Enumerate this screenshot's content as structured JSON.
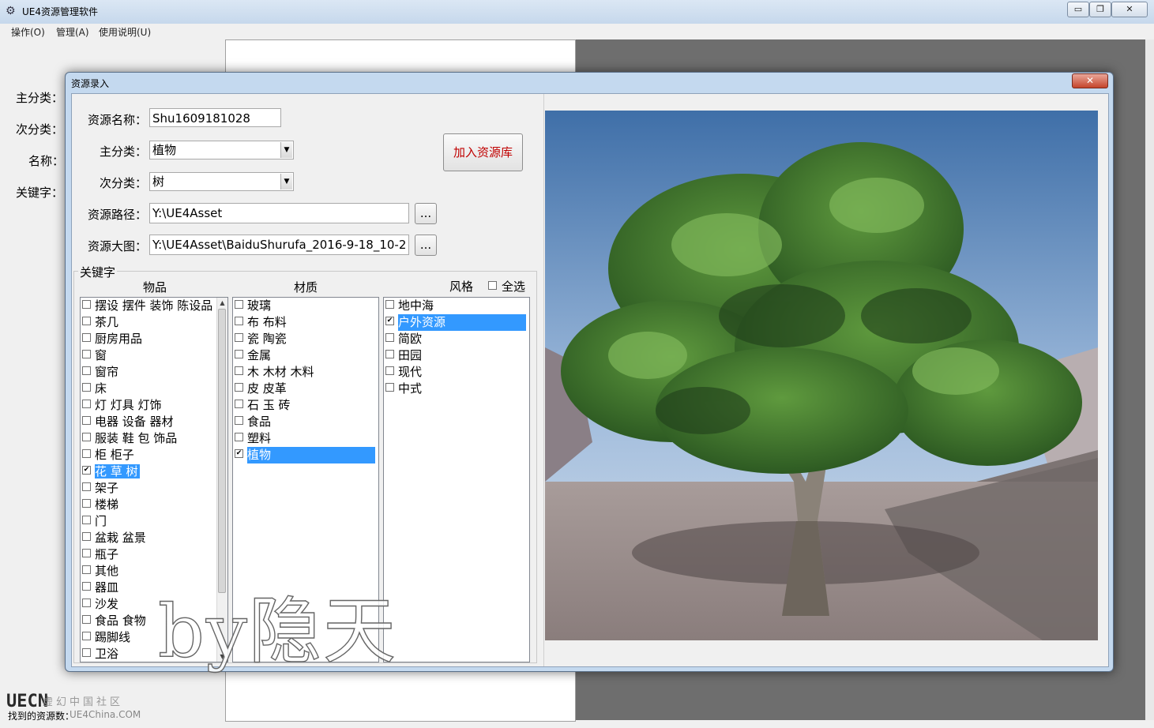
{
  "window": {
    "title": "UE4资源管理软件",
    "buttons": [
      "▭",
      "❐",
      "✕"
    ]
  },
  "menu": [
    "操作(O)",
    "管理(A)",
    "使用说明(U)"
  ],
  "side_labels": [
    "主分类：",
    "次分类：",
    "名称：",
    "关键字："
  ],
  "bottom_label": "找到的资源数：",
  "dialog": {
    "title": "资源录入",
    "close": "✕",
    "fields": {
      "name_label": "资源名称：",
      "name_value": "Shu1609181028",
      "main_cat_label": "主分类：",
      "main_cat_value": "植物",
      "sub_cat_label": "次分类：",
      "sub_cat_value": "树",
      "path_label": "资源路径：",
      "path_value": "Y:\\UE4Asset",
      "image_label": "资源大图：",
      "image_value": "Y:\\UE4Asset\\BaiduShurufa_2016-9-18_10-2",
      "browse": "..."
    },
    "add_button": "加入资源库",
    "keywords": {
      "group_title": "关键字",
      "col_items": "物品",
      "col_material": "材质",
      "col_style": "风格",
      "select_all": "全选",
      "items": [
        {
          "label": "摆设 摆件 装饰 陈设品",
          "checked": false
        },
        {
          "label": "茶几",
          "checked": false
        },
        {
          "label": "厨房用品",
          "checked": false
        },
        {
          "label": "窗",
          "checked": false
        },
        {
          "label": "窗帘",
          "checked": false
        },
        {
          "label": "床",
          "checked": false
        },
        {
          "label": "灯 灯具 灯饰",
          "checked": false
        },
        {
          "label": "电器 设备 器材",
          "checked": false
        },
        {
          "label": "服装 鞋 包 饰品",
          "checked": false
        },
        {
          "label": "柜 柜子",
          "checked": false
        },
        {
          "label": "花 草 树",
          "checked": true
        },
        {
          "label": "架子",
          "checked": false
        },
        {
          "label": "楼梯",
          "checked": false
        },
        {
          "label": "门",
          "checked": false
        },
        {
          "label": "盆栽 盆景",
          "checked": false
        },
        {
          "label": "瓶子",
          "checked": false
        },
        {
          "label": "其他",
          "checked": false
        },
        {
          "label": "器皿",
          "checked": false
        },
        {
          "label": "沙发",
          "checked": false
        },
        {
          "label": "食品 食物",
          "checked": false
        },
        {
          "label": "踢脚线",
          "checked": false
        },
        {
          "label": "卫浴",
          "checked": false
        }
      ],
      "materials": [
        {
          "label": "玻璃",
          "checked": false
        },
        {
          "label": "布 布料",
          "checked": false
        },
        {
          "label": "瓷 陶瓷",
          "checked": false
        },
        {
          "label": "金属",
          "checked": false
        },
        {
          "label": "木 木材 木料",
          "checked": false
        },
        {
          "label": "皮 皮革",
          "checked": false
        },
        {
          "label": "石 玉 砖",
          "checked": false
        },
        {
          "label": "食品",
          "checked": false
        },
        {
          "label": "塑料",
          "checked": false
        },
        {
          "label": "植物",
          "checked": true
        }
      ],
      "styles": [
        {
          "label": "地中海",
          "checked": false
        },
        {
          "label": "户外资源",
          "checked": true
        },
        {
          "label": "简欧",
          "checked": false
        },
        {
          "label": "田园",
          "checked": false
        },
        {
          "label": "现代",
          "checked": false
        },
        {
          "label": "中式",
          "checked": false
        }
      ]
    }
  },
  "watermark": "by隐天",
  "logo": {
    "mark": "UECN",
    "text": "虚幻中国社区",
    "url": "UE4China.COM"
  },
  "colors": {
    "selection": "#3399ff",
    "add_button_text": "#c00000",
    "titlebar": "#c6d8ec"
  }
}
